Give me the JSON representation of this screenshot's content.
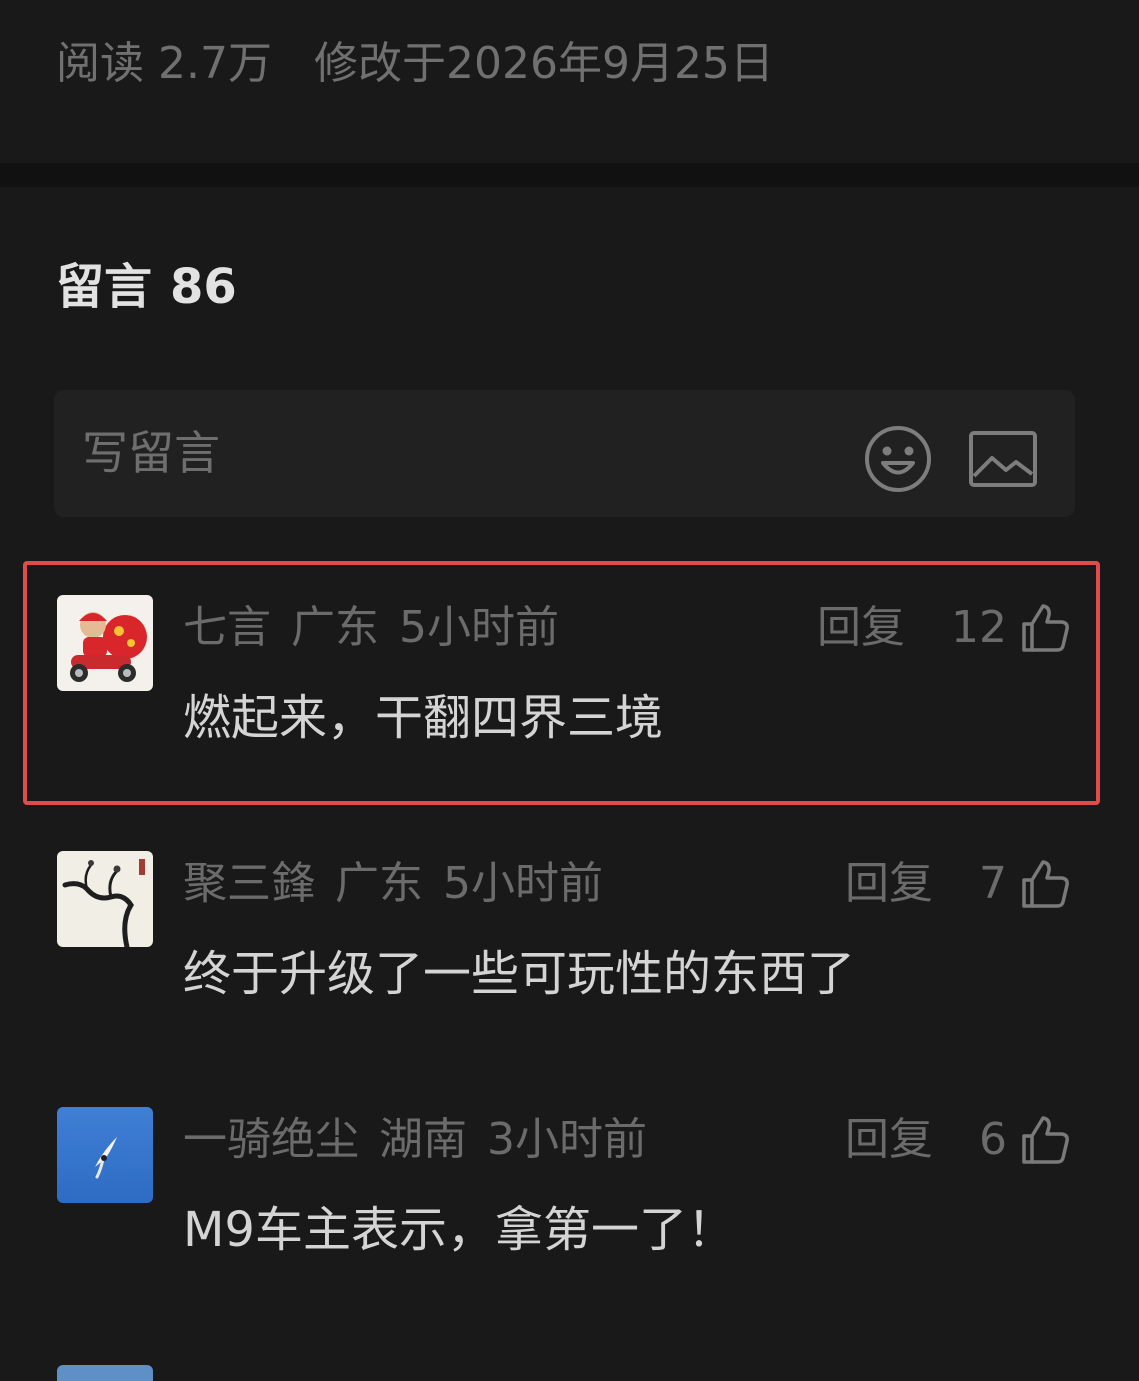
{
  "article": {
    "reads_label": "阅读 2.7万",
    "modified_label": "修改于2026年9月25日"
  },
  "comments_section": {
    "title": "留言",
    "count": "86"
  },
  "write_box": {
    "placeholder": "写留言",
    "icons": [
      "smiley-emoji-icon",
      "image-icon"
    ]
  },
  "comments": [
    {
      "author": "七言",
      "location": "广东",
      "time": "5小时前",
      "reply_label": "回复",
      "likes": "12",
      "text": "燃起来，干翻四界三境",
      "highlighted": true
    },
    {
      "author": "聚三鋒",
      "location": "广东",
      "time": "5小时前",
      "reply_label": "回复",
      "likes": "7",
      "text": "终于升级了一些可玩性的东西了",
      "highlighted": false
    },
    {
      "author": "一骑绝尘",
      "location": "湖南",
      "time": "3小时前",
      "reply_label": "回复",
      "likes": "6",
      "text": "M9车主表示，拿第一了！",
      "highlighted": false
    }
  ],
  "colors": {
    "background": "#191919",
    "separator": "#111111",
    "input_background": "#212121",
    "highlight_border": "#e24b4c",
    "muted_text": "#6b6b6b",
    "body_text": "#d4d4d4"
  }
}
